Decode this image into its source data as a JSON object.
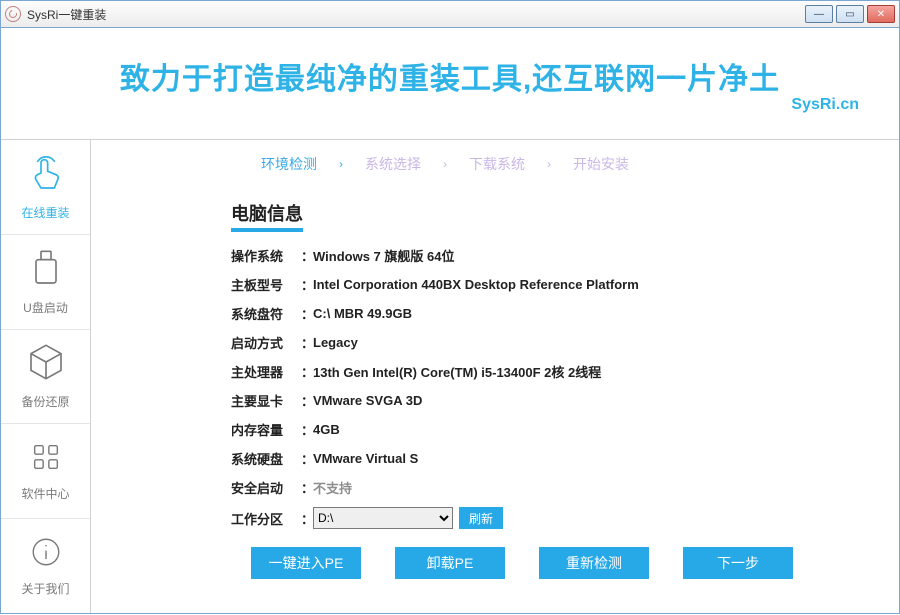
{
  "window": {
    "title": "SysRi一键重装"
  },
  "banner": {
    "main": "致力于打造最纯净的重装工具,还互联网一片净土",
    "sub": "SysRi.cn"
  },
  "sidebar": {
    "items": [
      {
        "label": "在线重装"
      },
      {
        "label": "U盘启动"
      },
      {
        "label": "备份还原"
      },
      {
        "label": "软件中心"
      },
      {
        "label": "关于我们"
      }
    ]
  },
  "steps": {
    "items": [
      {
        "label": "环境检测"
      },
      {
        "label": "系统选择"
      },
      {
        "label": "下载系统"
      },
      {
        "label": "开始安装"
      }
    ]
  },
  "section": {
    "title": "电脑信息"
  },
  "info": {
    "os": {
      "k": "操作系统",
      "v": "Windows 7 旗舰版   64位"
    },
    "board": {
      "k": "主板型号",
      "v": "Intel Corporation 440BX Desktop Reference Platform"
    },
    "sysdrive": {
      "k": "系统盘符",
      "v": "C:\\ MBR 49.9GB"
    },
    "boot": {
      "k": "启动方式",
      "v": "Legacy"
    },
    "cpu": {
      "k": "主处理器",
      "v": "13th Gen Intel(R) Core(TM) i5-13400F 2核 2线程"
    },
    "gpu": {
      "k": "主要显卡",
      "v": "VMware SVGA 3D"
    },
    "mem": {
      "k": "内存容量",
      "v": "4GB"
    },
    "disk": {
      "k": "系统硬盘",
      "v": "VMware Virtual S"
    },
    "secure": {
      "k": "安全启动",
      "v": "不支持"
    },
    "work": {
      "k": "工作分区",
      "v": "D:\\",
      "refresh": "刷新"
    }
  },
  "buttons": {
    "pe_enter": "一键进入PE",
    "pe_unload": "卸载PE",
    "recheck": "重新检测",
    "next": "下一步"
  }
}
